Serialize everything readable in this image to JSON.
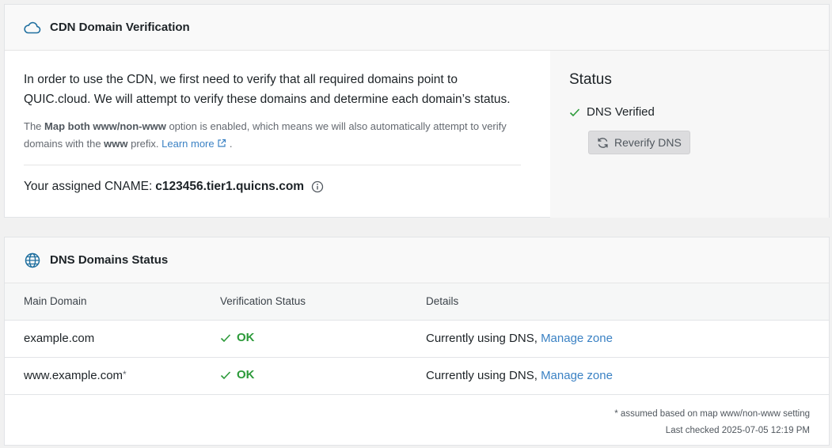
{
  "verification_card": {
    "title": "CDN Domain Verification",
    "icon": "cloud-icon",
    "intro": "In order to use the CDN, we first need to verify that all required domains point to QUIC.cloud. We will attempt to verify these domains and determine each domain’s status.",
    "note": {
      "prefix": "The ",
      "option_name": "Map both www/non-www",
      "middle": " option is enabled, which means we will also automatically attempt to verify domains with the ",
      "www_word": "www",
      "suffix": " prefix. ",
      "learn_more": "Learn more",
      "end": " ."
    },
    "cname_label": "Your assigned CNAME:",
    "cname_value": "c123456.tier1.quicns.com",
    "status": {
      "title": "Status",
      "verified_text": "DNS Verified",
      "reverify_label": "Reverify DNS"
    }
  },
  "dns_card": {
    "title": "DNS Domains Status",
    "icon": "globe-icon",
    "columns": [
      "Main Domain",
      "Verification Status",
      "Details"
    ],
    "rows": [
      {
        "domain": "example.com",
        "asterisk": "",
        "status": "OK",
        "details_text": "Currently using DNS,",
        "details_link": "Manage zone"
      },
      {
        "domain": "www.example.com",
        "asterisk": "*",
        "status": "OK",
        "details_text": "Currently using DNS,",
        "details_link": "Manage zone"
      }
    ],
    "footnote": "* assumed based on map www/non-www setting",
    "last_checked": "Last checked 2025-07-05 12:19 PM"
  },
  "colors": {
    "accent": "#1f6f9f",
    "link": "#3b82c4",
    "success": "#2c9a3a"
  }
}
